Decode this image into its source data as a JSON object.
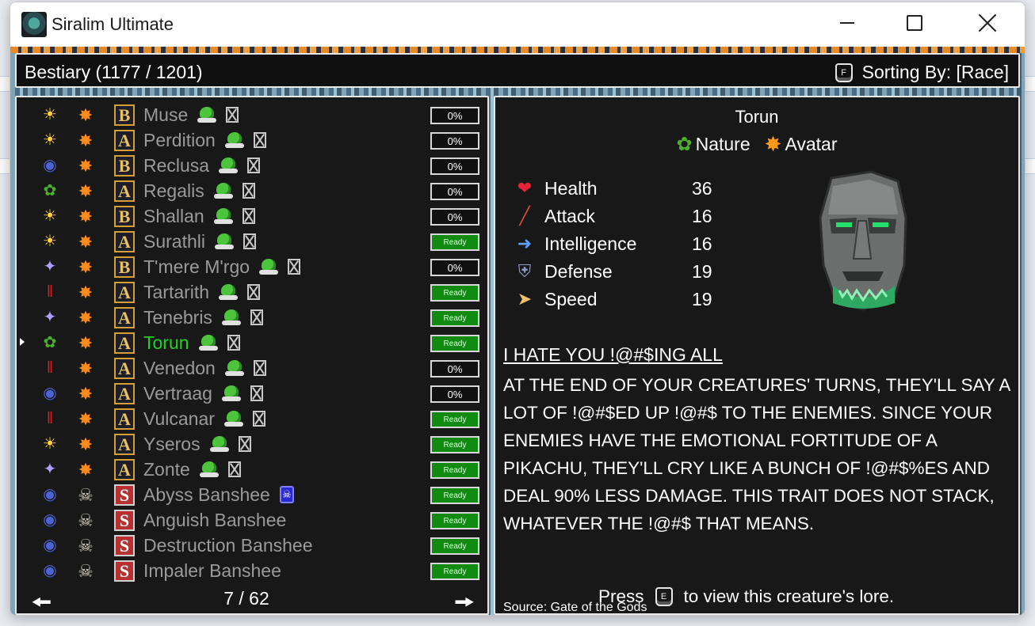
{
  "window": {
    "title": "Siralim Ultimate"
  },
  "header": {
    "title": "Bestiary (1177 / 1201)",
    "sort_key": "F",
    "sort_label": "Sorting By: [Race]"
  },
  "list": {
    "page": "7 / 62",
    "rows": [
      {
        "race_icon": "sun-icon",
        "class_icon": "burst-icon",
        "tier": "B",
        "name": "Muse",
        "extra": "goblin",
        "status": "0%"
      },
      {
        "race_icon": "sun-icon",
        "class_icon": "burst-icon",
        "tier": "A",
        "name": "Perdition",
        "extra": "goblin",
        "status": "0%"
      },
      {
        "race_icon": "blue-skull-icon",
        "class_icon": "burst-icon",
        "tier": "B",
        "name": "Reclusa",
        "extra": "goblin",
        "status": "0%"
      },
      {
        "race_icon": "leaf-icon",
        "class_icon": "burst-icon",
        "tier": "A",
        "name": "Regalis",
        "extra": "goblin",
        "status": "0%"
      },
      {
        "race_icon": "sun-icon",
        "class_icon": "burst-icon",
        "tier": "B",
        "name": "Shallan",
        "extra": "goblin",
        "status": "0%"
      },
      {
        "race_icon": "sun-icon",
        "class_icon": "burst-icon",
        "tier": "A",
        "name": "Surathli",
        "extra": "goblin",
        "status": "Ready"
      },
      {
        "race_icon": "sparkle-icon",
        "class_icon": "burst-icon",
        "tier": "B",
        "name": "T'mere M'rgo",
        "extra": "goblin",
        "status": "0%"
      },
      {
        "race_icon": "claw-icon",
        "class_icon": "burst-icon",
        "tier": "A",
        "name": "Tartarith",
        "extra": "goblin",
        "status": "Ready"
      },
      {
        "race_icon": "sparkle-icon",
        "class_icon": "burst-icon",
        "tier": "A",
        "name": "Tenebris",
        "extra": "goblin",
        "status": "Ready"
      },
      {
        "race_icon": "leaf-icon",
        "class_icon": "burst-icon",
        "tier": "A",
        "name": "Torun",
        "extra": "goblin",
        "status": "Ready",
        "selected": true
      },
      {
        "race_icon": "claw-icon",
        "class_icon": "burst-icon",
        "tier": "A",
        "name": "Venedon",
        "extra": "goblin",
        "status": "0%"
      },
      {
        "race_icon": "blue-skull-icon",
        "class_icon": "burst-icon",
        "tier": "A",
        "name": "Vertraag",
        "extra": "goblin",
        "status": "0%"
      },
      {
        "race_icon": "claw-icon",
        "class_icon": "burst-icon",
        "tier": "A",
        "name": "Vulcanar",
        "extra": "goblin",
        "status": "Ready"
      },
      {
        "race_icon": "sun-icon",
        "class_icon": "burst-icon",
        "tier": "A",
        "name": "Yseros",
        "extra": "goblin",
        "status": "Ready"
      },
      {
        "race_icon": "sparkle-icon",
        "class_icon": "burst-icon",
        "tier": "A",
        "name": "Zonte",
        "extra": "goblin",
        "status": "Ready"
      },
      {
        "race_icon": "blue-skull-icon",
        "class_icon": "horned-skull-icon",
        "tier": "S",
        "name": "Abyss Banshee",
        "extra": "skull",
        "status": "Ready"
      },
      {
        "race_icon": "blue-skull-icon",
        "class_icon": "horned-skull-icon",
        "tier": "S",
        "name": "Anguish Banshee",
        "extra": "",
        "status": "Ready"
      },
      {
        "race_icon": "blue-skull-icon",
        "class_icon": "horned-skull-icon",
        "tier": "S",
        "name": "Destruction Banshee",
        "extra": "",
        "status": "Ready"
      },
      {
        "race_icon": "blue-skull-icon",
        "class_icon": "horned-skull-icon",
        "tier": "S",
        "name": "Impaler Banshee",
        "extra": "",
        "status": "Ready"
      }
    ]
  },
  "detail": {
    "name": "Torun",
    "class1": "Nature",
    "class2": "Avatar",
    "stats": [
      {
        "icon": "heart-icon",
        "label": "Health",
        "value": "36"
      },
      {
        "icon": "sword-icon",
        "label": "Attack",
        "value": "16"
      },
      {
        "icon": "lightning-icon",
        "label": "Intelligence",
        "value": "16"
      },
      {
        "icon": "shield-icon",
        "label": "Defense",
        "value": "19"
      },
      {
        "icon": "wing-icon",
        "label": "Speed",
        "value": "19"
      }
    ],
    "trait_title": "I HATE YOU !@#$ING ALL",
    "trait_desc": "AT THE END OF YOUR CREATURES' TURNS, THEY'LL SAY A LOT OF !@#$ED UP !@#$ TO THE ENEMIES. SINCE YOUR ENEMIES HAVE THE EMOTIONAL FORTITUDE OF A PIKACHU, THEY'LL CRY LIKE A BUNCH OF !@#$%ES AND DEAL 90% LESS DAMAGE. THIS TRAIT DOES NOT STACK, WHATEVER THE !@#$ THAT MEANS.",
    "press_label": "Press",
    "press_key": "E",
    "press_rest": "to view this creature's lore.",
    "source": "Source: Gate of the Gods"
  }
}
